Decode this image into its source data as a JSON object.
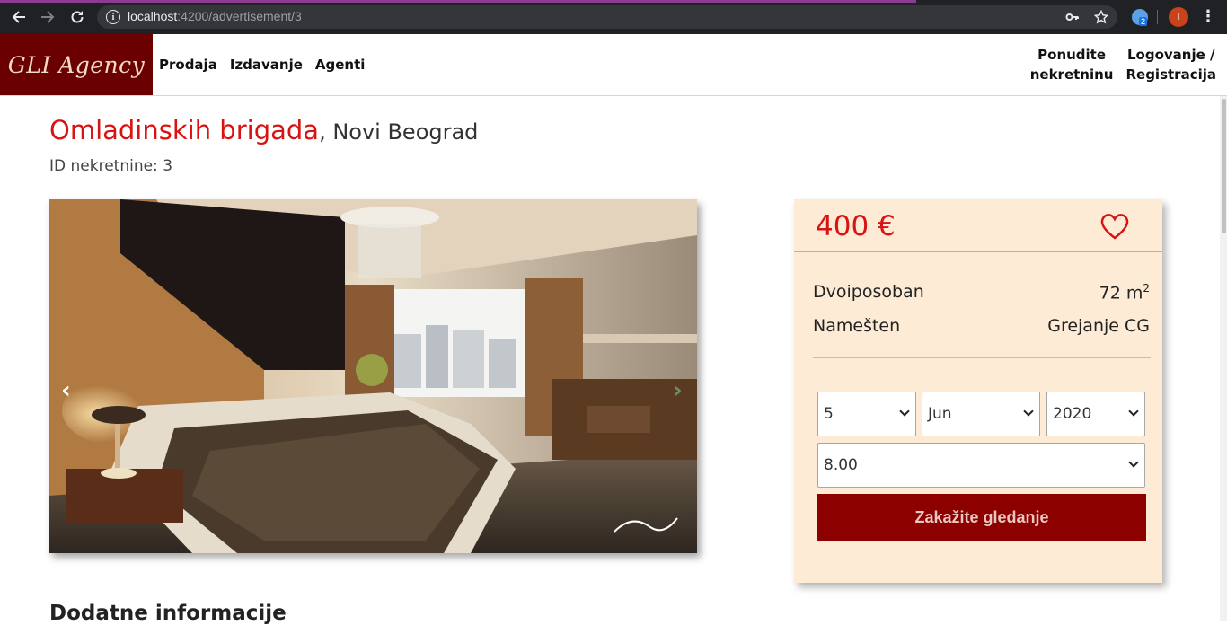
{
  "browser": {
    "url_host": "localhost",
    "url_path": ":4200/advertisement/3",
    "extension_badge": "2",
    "profile_initial": "I",
    "accent_color": "#8e3a8e"
  },
  "header": {
    "logo_text": "GLI Agency",
    "nav_left": [
      "Prodaja",
      "Izdavanje",
      "Agenti"
    ],
    "offer_line1": "Ponudite",
    "offer_line2": "nekretninu",
    "login_line1": "Logovanje /",
    "login_line2": "Registracija",
    "logo_bg": "#6b0000"
  },
  "property": {
    "street": "Omladinskih brigada",
    "city": ", Novi Beograd",
    "id_label": "ID nekretnine: 3",
    "image_alt": "bedroom photo",
    "prev_label": "‹",
    "next_label": "›"
  },
  "card": {
    "price": "400 €",
    "rooms": "Dvoiposoban",
    "area": "72 m",
    "area_exp": "2",
    "furnished": "Nameš­ten",
    "heating": "Grejanje CG",
    "day": "5",
    "month": "Jun",
    "year": "2020",
    "time": "8.00",
    "book_label": "Zakažite gledanje",
    "bg_color": "#fdebd5",
    "button_color": "#8c0000",
    "price_color": "#d81313"
  },
  "section": {
    "more_info": "Dodatne informacije"
  }
}
